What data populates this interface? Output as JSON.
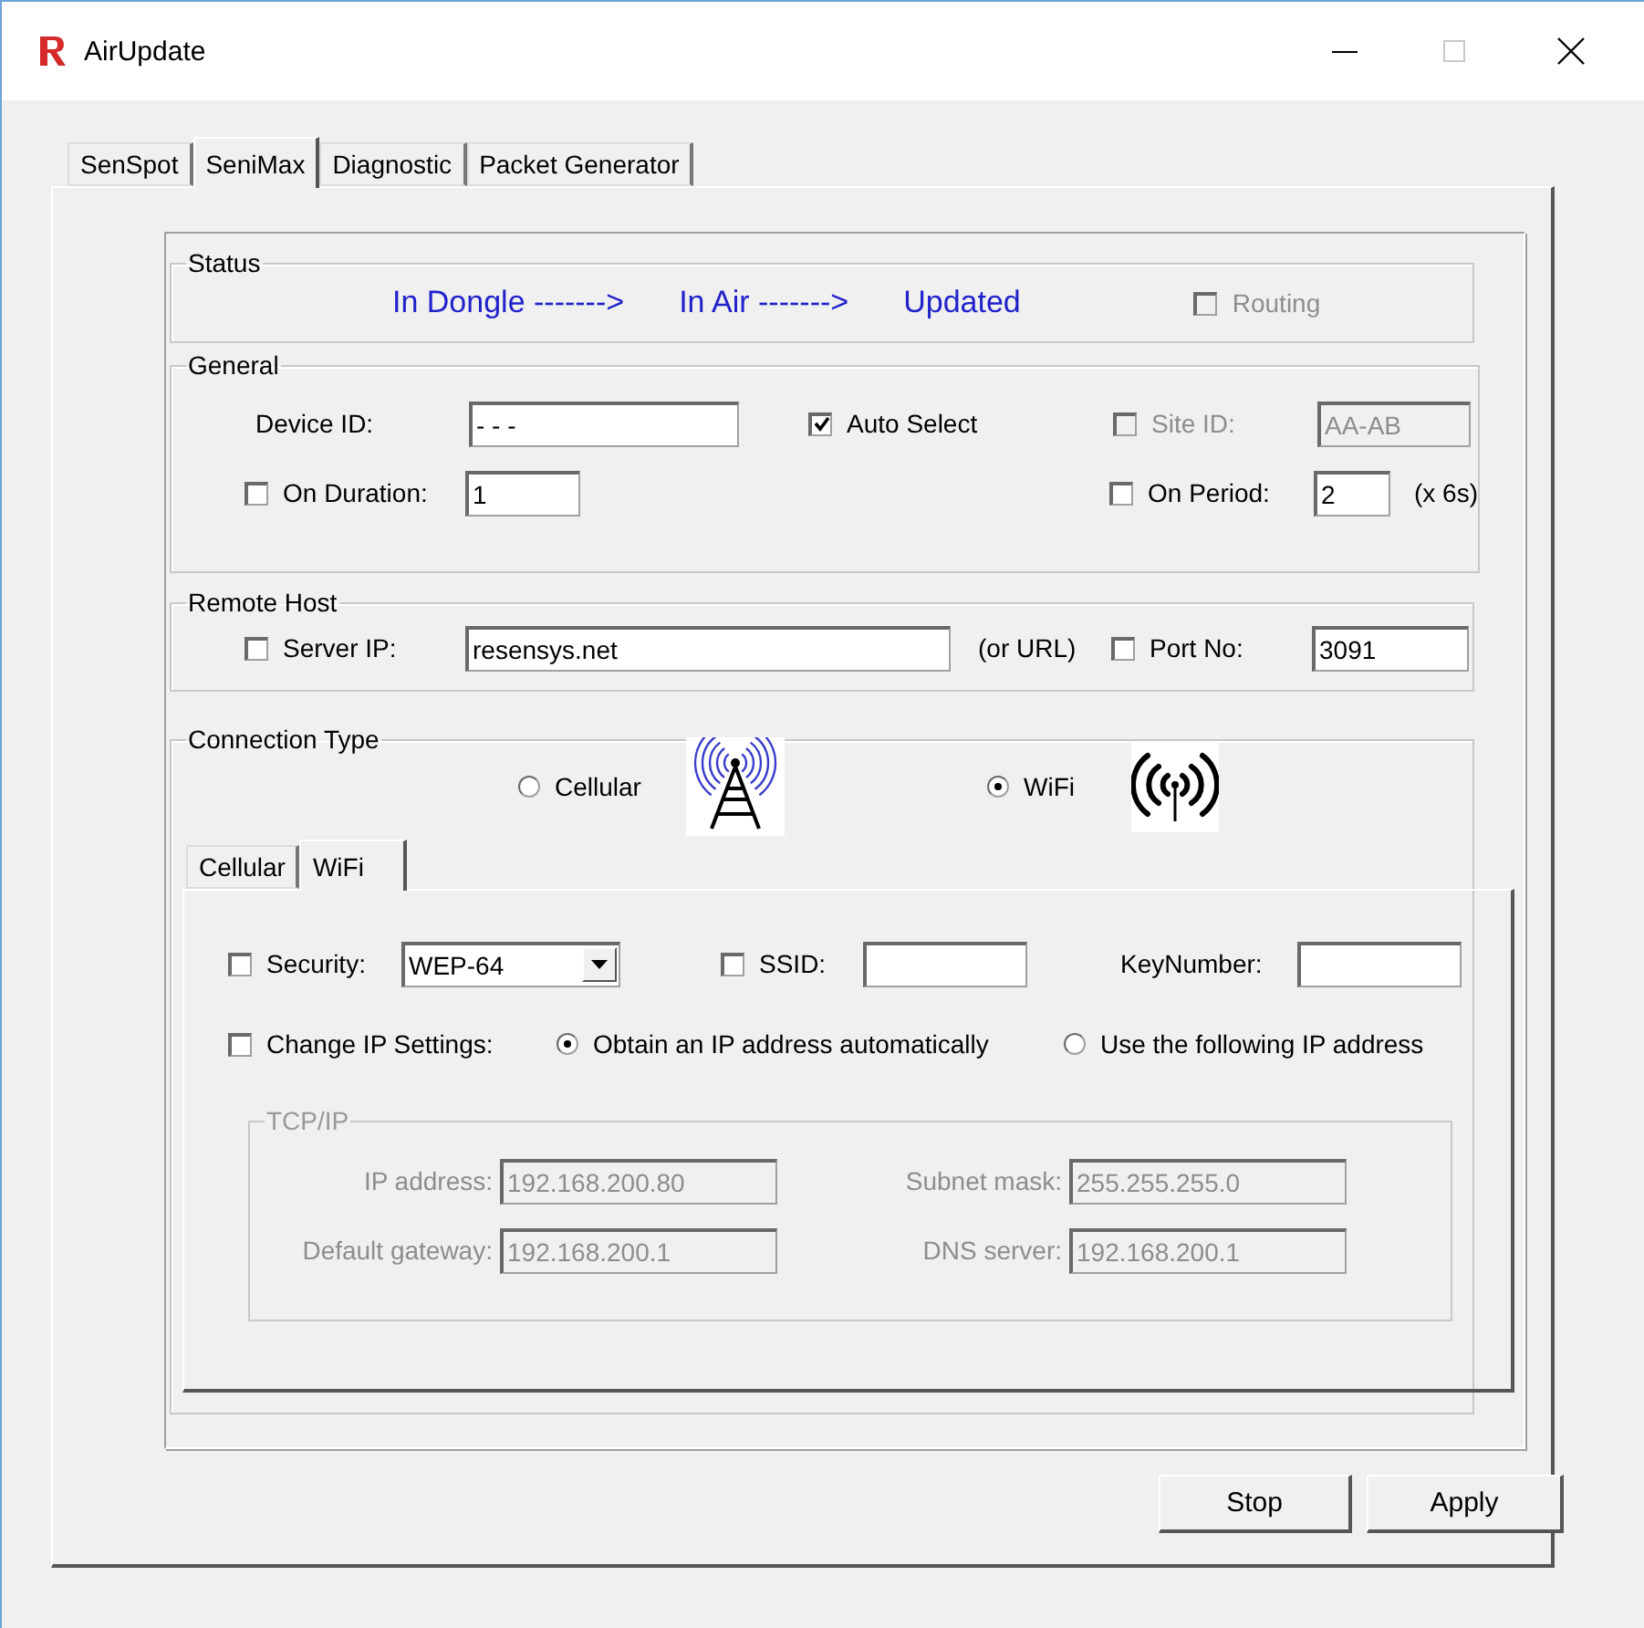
{
  "window": {
    "title": "AirUpdate"
  },
  "tabs": [
    {
      "label": "SenSpot",
      "selected": false
    },
    {
      "label": "SeniMax",
      "selected": true
    },
    {
      "label": "Diagnostic",
      "selected": false
    },
    {
      "label": "Packet Generator",
      "selected": false
    }
  ],
  "status": {
    "title": "Status",
    "stages": [
      "In Dongle ------->",
      "In Air ------->",
      "Updated"
    ],
    "routing": {
      "label": "Routing",
      "checked": false,
      "disabled": true
    }
  },
  "general": {
    "title": "General",
    "device_id": {
      "label": "Device ID:",
      "value": "- - -"
    },
    "auto_select": {
      "label": "Auto Select",
      "checked": true
    },
    "site_id": {
      "label": "Site ID:",
      "checked": false,
      "disabled": true,
      "value": "AA-AB"
    },
    "on_duration": {
      "label": "On Duration:",
      "checked": false,
      "value": "1"
    },
    "on_period": {
      "label": "On Period:",
      "checked": false,
      "value": "2",
      "unit": "(x 6s)"
    }
  },
  "remote_host": {
    "title": "Remote Host",
    "server_ip": {
      "label": "Server IP:",
      "checked": false,
      "value": "resensys.net",
      "note": "(or URL)"
    },
    "port": {
      "label": "Port No:",
      "checked": false,
      "value": "3091"
    }
  },
  "connection_type": {
    "title": "Connection Type",
    "options": [
      {
        "kind": "cellular",
        "label": "Cellular",
        "selected": false
      },
      {
        "kind": "wifi",
        "label": "WiFi",
        "selected": true
      }
    ],
    "tabs": [
      {
        "label": "Cellular",
        "selected": false
      },
      {
        "label": "WiFi",
        "selected": true
      }
    ],
    "wifi": {
      "security": {
        "label": "Security:",
        "checked": false,
        "value": "WEP-64"
      },
      "ssid": {
        "label": "SSID:",
        "checked": false
      },
      "key_number": {
        "label": "KeyNumber:"
      },
      "change_ip": {
        "label": "Change IP Settings:",
        "checked": false
      },
      "ip_modes": [
        {
          "label": "Obtain an IP address automatically",
          "selected": true
        },
        {
          "label": "Use the following IP address",
          "selected": false
        }
      ],
      "tcpip": {
        "title": "TCP/IP",
        "disabled": true,
        "fields": [
          {
            "label": "IP address:",
            "value": "192.168.200.80"
          },
          {
            "label": "Subnet mask:",
            "value": "255.255.255.0"
          },
          {
            "label": "Default gateway:",
            "value": "192.168.200.1"
          },
          {
            "label": "DNS server:",
            "value": "192.168.200.1"
          }
        ]
      }
    }
  },
  "buttons": [
    {
      "label": "Stop"
    },
    {
      "label": "Apply"
    }
  ]
}
